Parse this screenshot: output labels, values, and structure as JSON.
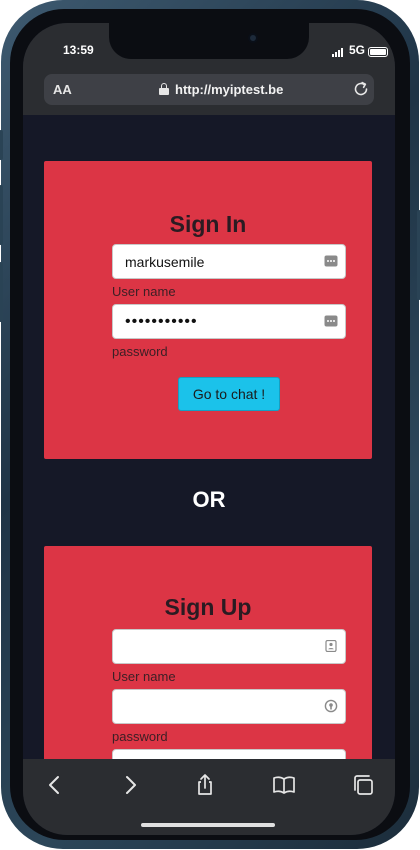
{
  "status_bar": {
    "time": "13:59",
    "network": "5G",
    "icons": [
      "signal-bars-icon",
      "battery-icon"
    ]
  },
  "browser": {
    "reader_label": "AA",
    "url": "http://myiptest.be",
    "icons": [
      "lock-icon",
      "reload-icon"
    ]
  },
  "sign_in": {
    "title": "Sign In",
    "username_value": "markusemile",
    "username_label": "User name",
    "password_value": "•••••••••••",
    "password_label": "password",
    "submit_label": "Go to chat !",
    "field_icon": "password-keys-icon"
  },
  "separator": {
    "label": "OR"
  },
  "sign_up": {
    "title": "Sign Up",
    "username_value": "",
    "username_label": "User name",
    "password_value": "",
    "password_label": "password",
    "icons": [
      "contact-card-icon",
      "location-key-icon"
    ]
  },
  "toolbar": {
    "icons": [
      "back-icon",
      "forward-icon",
      "share-icon",
      "bookmarks-icon",
      "tabs-icon"
    ]
  },
  "colors": {
    "page_background": "#151827",
    "card": "#dc3545",
    "button": "#1bc2ea",
    "browser_chrome": "#2b2d31"
  }
}
